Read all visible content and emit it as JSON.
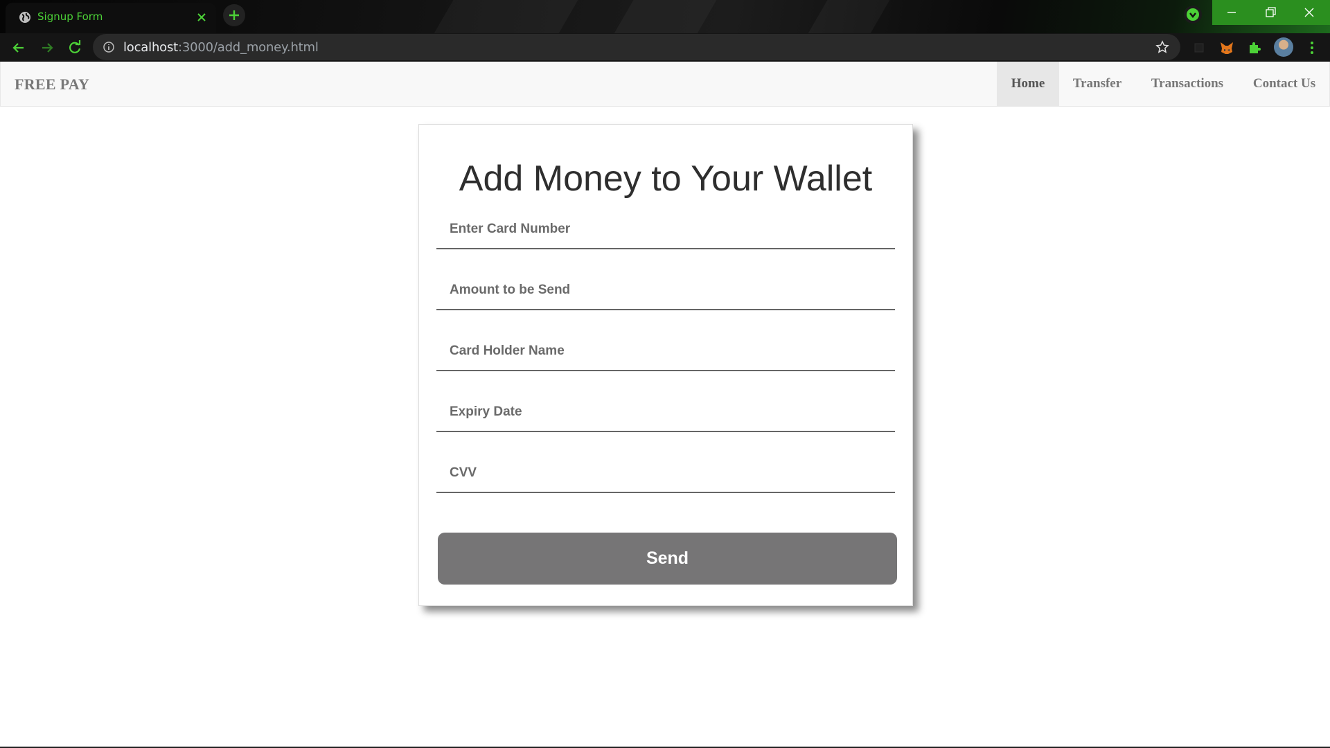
{
  "browser": {
    "tab_title": "Signup Form",
    "url_host": "localhost",
    "url_rest": ":3000/add_money.html",
    "accent_color": "#4cd137",
    "icons": {
      "tab_favicon": "globe-icon",
      "tab_close": "close-icon",
      "new_tab": "plus-icon",
      "back": "arrow-left-icon",
      "forward": "arrow-right-icon",
      "reload": "reload-icon",
      "site_info": "info-icon",
      "bookmark": "star-icon",
      "extension_1": "square-icon",
      "extension_2": "fox-icon",
      "extensions": "puzzle-icon",
      "menu": "kebab-menu-icon"
    }
  },
  "navbar": {
    "brand": "FREE PAY",
    "items": [
      {
        "label": "Home",
        "active": true
      },
      {
        "label": "Transfer",
        "active": false
      },
      {
        "label": "Transactions",
        "active": false
      },
      {
        "label": "Contact Us",
        "active": false
      }
    ]
  },
  "form": {
    "title": "Add Money to Your Wallet",
    "fields": [
      {
        "placeholder": "Enter Card Number",
        "value": ""
      },
      {
        "placeholder": "Amount to be Send",
        "value": ""
      },
      {
        "placeholder": "Card Holder Name",
        "value": ""
      },
      {
        "placeholder": "Expiry Date",
        "value": ""
      },
      {
        "placeholder": "CVV",
        "value": ""
      }
    ],
    "submit_label": "Send",
    "button_color": "#767576"
  }
}
